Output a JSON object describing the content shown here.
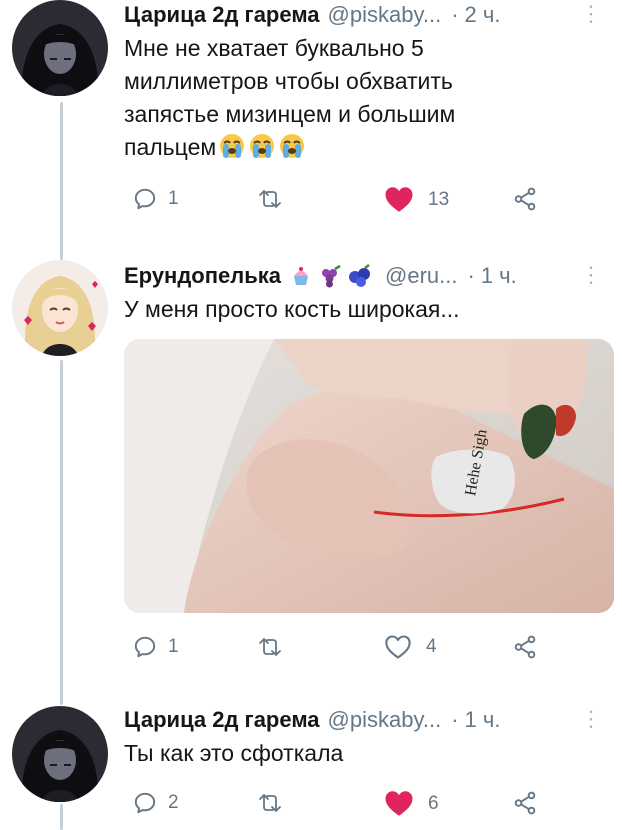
{
  "tweets": [
    {
      "name": "Царица 2д гарема",
      "handle": "@piskaby...",
      "dot": "·",
      "time": "2 ч.",
      "text_lines": [
        "Мне не хватает буквально 5",
        "миллиметров чтобы обхватить",
        "запястье мизинцем и большим",
        "пальцем"
      ],
      "emojis": [
        "crying-face",
        "crying-face",
        "crying-face"
      ],
      "reply_count": "1",
      "retweet_count": "",
      "like_count": "13",
      "liked": true
    },
    {
      "name": "Ерундопелька",
      "name_emojis": [
        "cupcake",
        "grapes",
        "blueberries"
      ],
      "handle": "@eru...",
      "dot": "·",
      "time": "1 ч.",
      "text_lines": [
        "У меня просто кость широкая..."
      ],
      "image_text": "Hehe Sigh",
      "reply_count": "1",
      "retweet_count": "",
      "like_count": "4",
      "liked": false
    },
    {
      "name": "Царица 2д гарема",
      "handle": "@piskaby...",
      "dot": "·",
      "time": "1 ч.",
      "text_lines": [
        "Ты как это сфоткала"
      ],
      "reply_count": "2",
      "retweet_count": "",
      "like_count": "6",
      "liked": true
    }
  ],
  "more_glyph": "⋮",
  "colors": {
    "like_red": "#e0245e",
    "icon_grey": "#657786",
    "thread_line": "#c4cfd6"
  }
}
